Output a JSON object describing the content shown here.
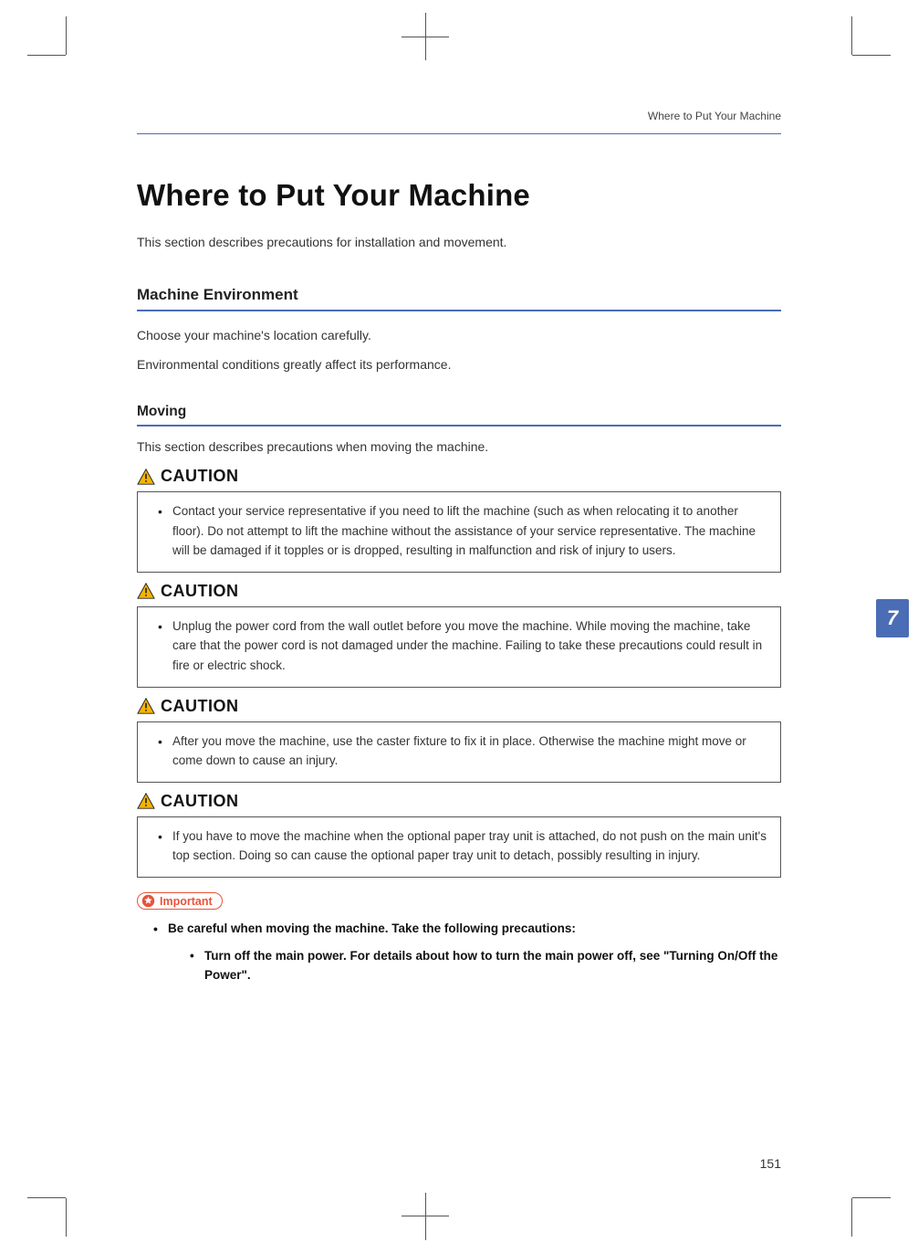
{
  "running_head": "Where to Put Your Machine",
  "title": "Where to Put Your Machine",
  "intro": "This section describes precautions for installation and movement.",
  "section1": {
    "heading": "Machine Environment",
    "p1": "Choose your machine's location carefully.",
    "p2": "Environmental conditions greatly affect its performance."
  },
  "section2": {
    "heading": "Moving",
    "intro": "This section describes precautions when moving the machine."
  },
  "caution_label": "CAUTION",
  "cautions": [
    "Contact your service representative if you need to lift the machine (such as when relocating it to another floor). Do not attempt to lift the machine without the assistance of your service representative. The machine will be damaged if it topples or is dropped, resulting in malfunction and risk of injury to users.",
    "Unplug the power cord from the wall outlet before you move the machine. While moving the machine, take care that the power cord is not damaged under the machine. Failing to take these precautions could result in fire or electric shock.",
    "After you move the machine, use the caster fixture to fix it in place. Otherwise the machine might move or come down to cause an injury.",
    "If you have to move the machine when the optional paper tray unit is attached, do not push on the main unit's top section. Doing so can cause the optional paper tray unit to detach, possibly resulting in injury."
  ],
  "important_label": "Important",
  "important": {
    "lead": "Be careful when moving the machine. Take the following precautions:",
    "sub1": "Turn off the main power. For details about how to turn the main power off, see \"Turning On/Off the Power\"."
  },
  "side_tab": "7",
  "page_number": "151"
}
